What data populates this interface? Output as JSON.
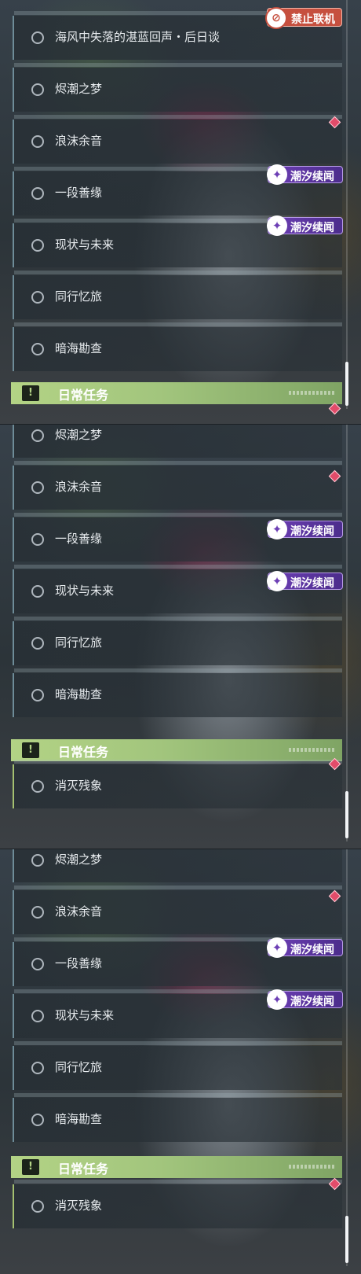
{
  "tags": {
    "no_online": "禁止联机",
    "tide_tales": "潮汐续闻"
  },
  "daily_header": "日常任务",
  "quest_items": [
    "海风中失落的湛蓝回声・后日谈",
    "烬潮之梦",
    "浪沫余音",
    "一段善缘",
    "现状与未来",
    "同行忆旅",
    "暗海勘查",
    "消灭残象"
  ],
  "icons": {
    "quest_status": "circle-outline-icon",
    "daily_header": "exclamation-icon",
    "no_online": "no-multiplayer-icon",
    "tide_tales": "tide-tales-emblem-icon",
    "new_marker": "red-diamond-icon"
  },
  "colors": {
    "daily_green": "#b3d385",
    "tag_purple": "#6d3fb5",
    "tag_red": "#c6503f",
    "marker_red": "#e24c6a"
  }
}
